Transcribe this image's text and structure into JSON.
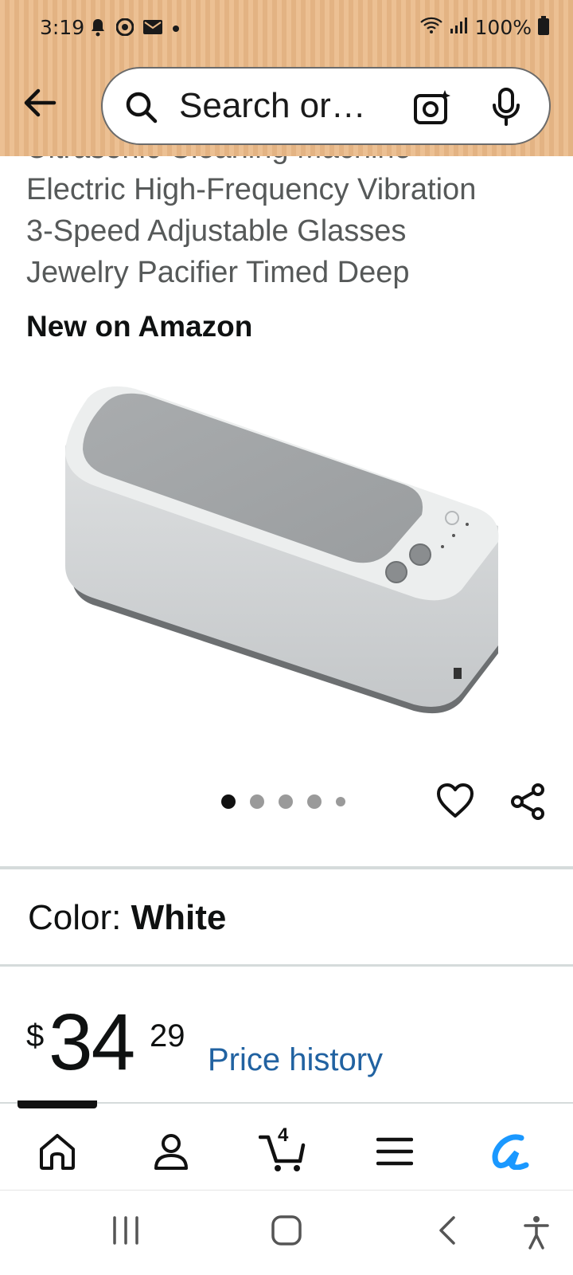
{
  "status_bar": {
    "time": "3:19",
    "battery_percent": "100%",
    "notification_icons": [
      "bell-icon",
      "chrome-icon",
      "mail-icon",
      "dot-icon"
    ],
    "system_icons": [
      "wifi-icon",
      "signal-icon",
      "battery-icon"
    ]
  },
  "search": {
    "placeholder": "Search or…"
  },
  "product": {
    "title_lines": [
      "Ultrasonic Cleaning Machine",
      "Electric High-Frequency Vibration",
      "3-Speed Adjustable Glasses",
      "Jewelry Pacifier Timed Deep"
    ],
    "badge": "New on Amazon",
    "image_description_icon": "ultrasonic-cleaner-image",
    "carousel": {
      "total": 5,
      "active_index": 0
    },
    "color_label": "Color:",
    "color_value": "White",
    "price_symbol": "$",
    "price_whole": "34",
    "price_fraction": "29",
    "price_history_label": "Price history"
  },
  "bottom_nav": {
    "items": [
      "home-icon",
      "account-icon",
      "cart-icon",
      "menu-icon",
      "rufus-icon"
    ],
    "cart_count": "4"
  },
  "colors": {
    "header_bg": "#eab987",
    "link_blue": "#2162a1",
    "rufus_blue": "#1a98ff"
  }
}
